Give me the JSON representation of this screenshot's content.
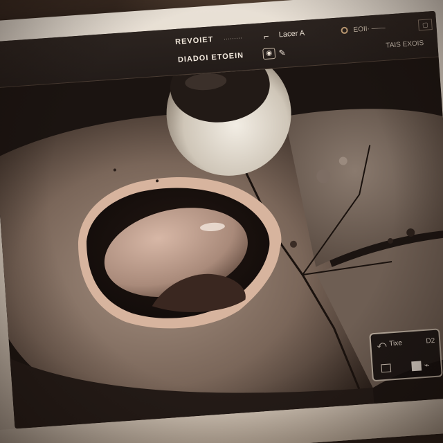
{
  "topbar": {
    "title": "REVOIET",
    "subtitle": "·········",
    "menu_label": "Lacer A",
    "status_text": "EOII· ——",
    "heading": "DIADOI ETOEIN",
    "right_text": "TAIS EXOIS"
  },
  "hud": {
    "label": "Tixe",
    "badge": "D2"
  },
  "icons": {
    "cursor": "cursor-icon",
    "mode": "camera-icon",
    "pen": "pen-icon",
    "back": "back-arrow-icon",
    "frame": "frame-icon",
    "trend": "trend-icon"
  },
  "colors": {
    "screen_bg": "#1e1714",
    "terrain": "#7c6a5e",
    "crater_rim": "#d9b8a2",
    "moon": "#d8d0c4",
    "bezel": "#e9e1d6"
  }
}
